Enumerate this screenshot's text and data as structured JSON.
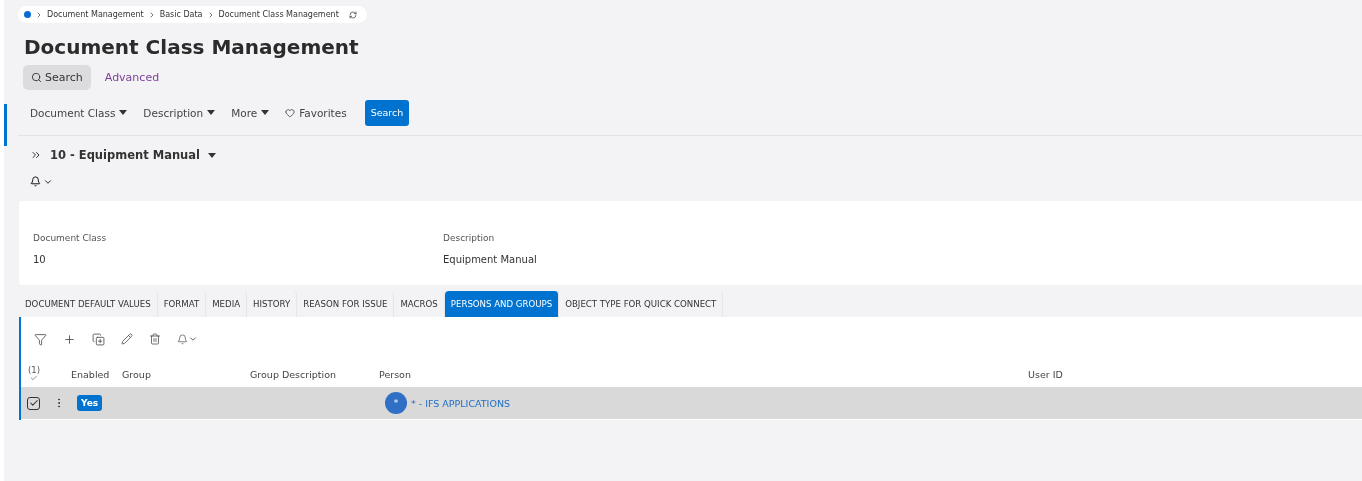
{
  "breadcrumb": [
    "Document Management",
    "Basic Data",
    "Document Class Management"
  ],
  "title": "Document Class Management",
  "search_modes": [
    {
      "label": "Search",
      "selected": true
    },
    {
      "label": "Advanced",
      "selected": false
    }
  ],
  "filters": [
    {
      "label": "Document Class",
      "kind": "dropdown"
    },
    {
      "label": "Description",
      "kind": "dropdown"
    },
    {
      "label": "More",
      "kind": "dropdown"
    },
    {
      "label": "Favorites",
      "kind": "favorite"
    }
  ],
  "search_button": "Search",
  "record": "10 - Equipment Manual",
  "details": [
    {
      "label": "Document Class",
      "value": "10"
    },
    {
      "label": "Description",
      "value": "Equipment Manual"
    }
  ],
  "tabs": [
    {
      "label": "DOCUMENT DEFAULT VALUES",
      "selected": false
    },
    {
      "label": "FORMAT",
      "selected": false
    },
    {
      "label": "MEDIA",
      "selected": false
    },
    {
      "label": "HISTORY",
      "selected": false
    },
    {
      "label": "REASON FOR ISSUE",
      "selected": false
    },
    {
      "label": "MACROS",
      "selected": false
    },
    {
      "label": "PERSONS AND GROUPS",
      "selected": true
    },
    {
      "label": "OBJECT TYPE FOR QUICK CONNECT",
      "selected": false
    }
  ],
  "table": {
    "selection_count": "(1)",
    "columns": [
      "Enabled",
      "Group",
      "Group Description",
      "Person",
      "User ID"
    ],
    "rows": [
      {
        "checked": true,
        "enabled": "Yes",
        "person_avatar": "*",
        "person": "* - IFS APPLICATIONS"
      }
    ]
  }
}
